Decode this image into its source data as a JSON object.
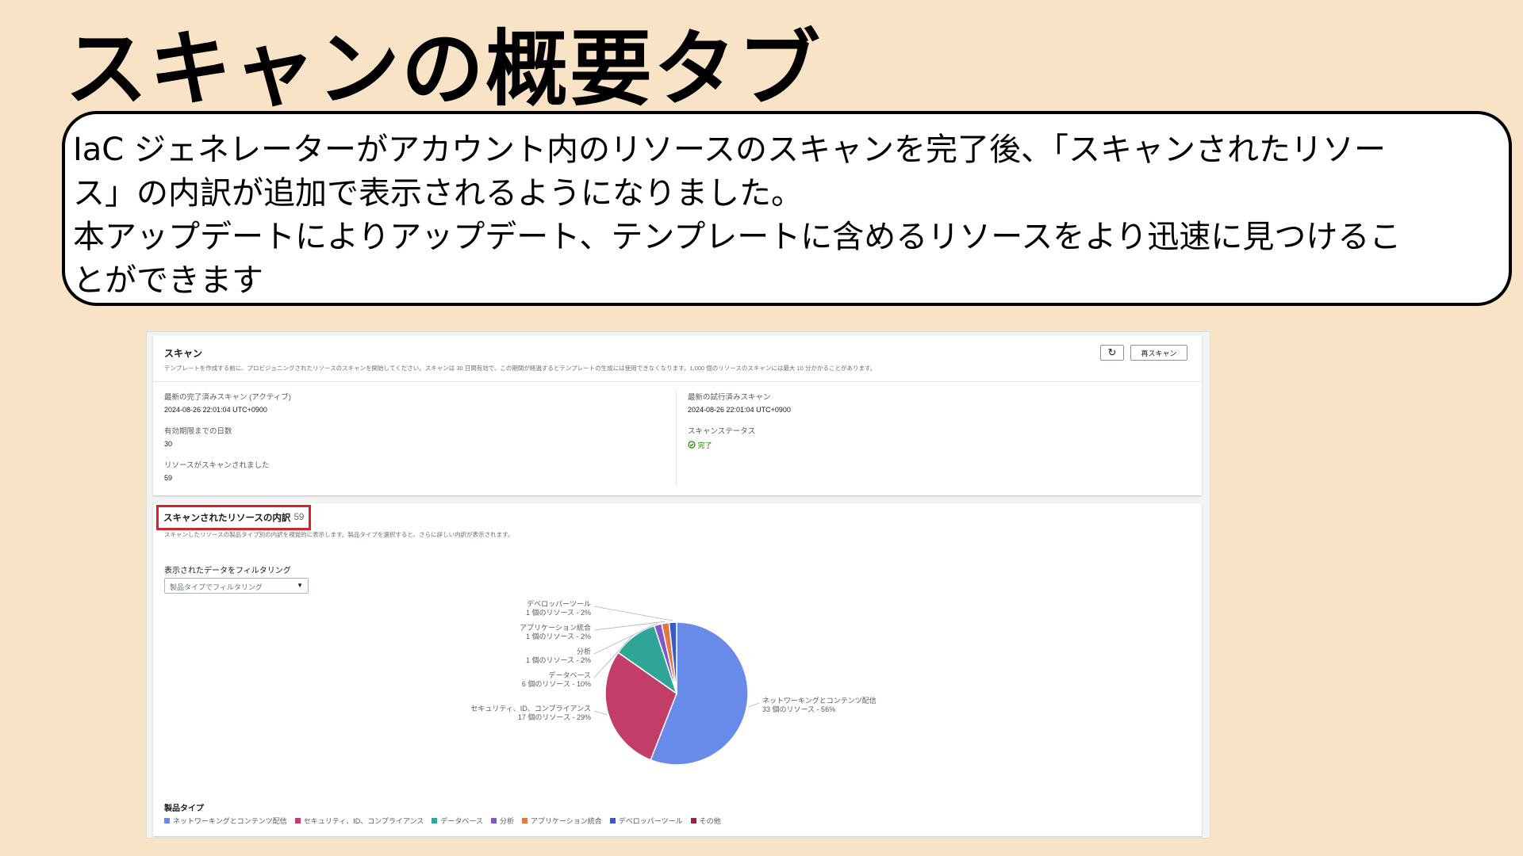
{
  "slide": {
    "title": "スキャンの概要タブ",
    "callout_lines": [
      "IaC ジェネレーターがアカウント内のリソースのスキャンを完了後、「スキャンされたリソー",
      "ス」の内訳が追加で表示されるようになりました。",
      "本アップデートによりアップデート、テンプレートに含めるリソースをより迅速に見つけるこ",
      "とができます"
    ]
  },
  "scan": {
    "title": "スキャン",
    "description": "テンプレートを作成する前に、プロビジョニングされたリソースのスキャンを開始してください。スキャンは 30 日間有効で、この期間が経過するとテンプレートの生成には使用できなくなります。1,000 個のリソースのスキャンには最大 10 分かかることがあります。",
    "refresh_icon": "↻",
    "rescan_label": "再スキャン",
    "latest_completed_label": "最新の完了済みスキャン (アクティブ)",
    "latest_completed_value": "2024-08-26 22:01:04 UTC+0900",
    "days_label": "有効期限までの日数",
    "days_value": "30",
    "resources_label": "リソースがスキャンされました",
    "resources_value": "59",
    "latest_attempt_label": "最新の試行済みスキャン",
    "latest_attempt_value": "2024-08-26 22:01:04 UTC+0900",
    "status_label": "スキャンステータス",
    "status_value": "完了",
    "status_icon": "check-circle"
  },
  "breakdown": {
    "title": "スキャンされたリソースの内訳",
    "count": "59",
    "description": "スキャンしたリソースの製品タイプ別の内訳を視覚的に表示します。製品タイプを選択すると、さらに詳しい内訳が表示されます。",
    "filter_label": "表示されたデータをフィルタリング",
    "filter_placeholder": "製品タイプでフィルタリング",
    "legend_title": "製品タイプ"
  },
  "chart_data": {
    "type": "pie",
    "slices": [
      {
        "name": "ネットワーキングとコンテンツ配信",
        "count": 33,
        "percent": 56,
        "color": "#688ae8",
        "note": "33 個のリソース - 56%"
      },
      {
        "name": "セキュリティ、ID、コンプライアンス",
        "count": 17,
        "percent": 29,
        "color": "#c33d69",
        "note": "17 個のリソース - 29%"
      },
      {
        "name": "データベース",
        "count": 6,
        "percent": 10,
        "color": "#2ea597",
        "note": "6 個のリソース - 10%"
      },
      {
        "name": "分析",
        "count": 1,
        "percent": 2,
        "color": "#8456ce",
        "note": "1 個のリソース - 2%"
      },
      {
        "name": "アプリケーション統合",
        "count": 1,
        "percent": 2,
        "color": "#e07941",
        "note": "1 個のリソース - 2%"
      },
      {
        "name": "デベロッパーツール",
        "count": 1,
        "percent": 2,
        "color": "#3759ce",
        "note": "1 個のリソース - 2%"
      }
    ],
    "legend": [
      {
        "name": "ネットワーキングとコンテンツ配信",
        "color": "#688ae8"
      },
      {
        "name": "セキュリティ、ID、コンプライアンス",
        "color": "#c33d69"
      },
      {
        "name": "データベース",
        "color": "#2ea597"
      },
      {
        "name": "分析",
        "color": "#8456ce"
      },
      {
        "name": "アプリケーション統合",
        "color": "#e07941"
      },
      {
        "name": "デベロッパーツール",
        "color": "#3759ce"
      },
      {
        "name": "その他",
        "color": "#962249"
      }
    ]
  }
}
